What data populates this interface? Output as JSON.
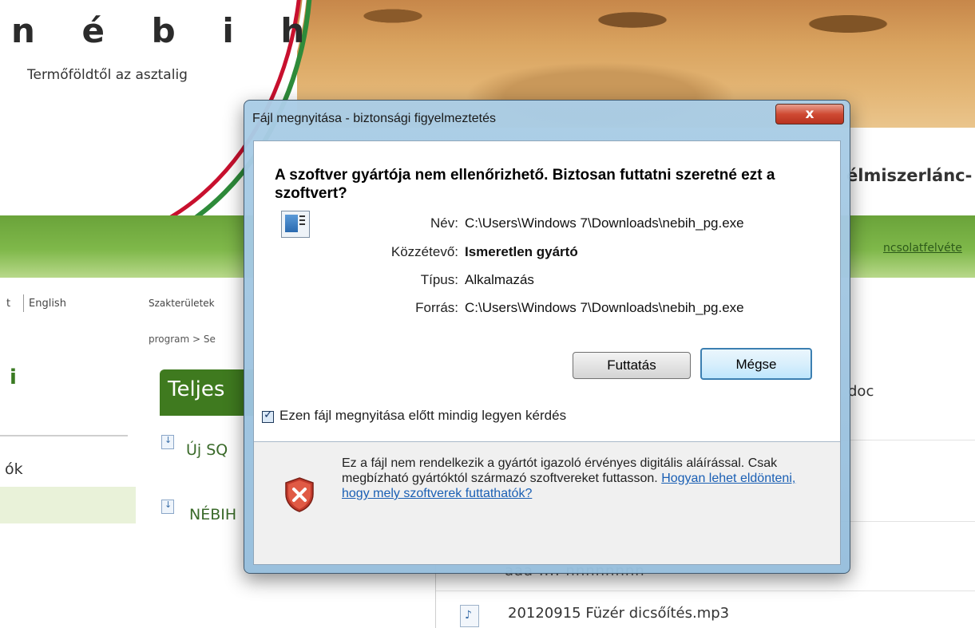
{
  "site": {
    "logo": "n é b i h",
    "tagline": "Termőföldtől az asztalig",
    "header_right_text": "élmiszerlánc-",
    "greenbar_link": "ncsolatfelvéte",
    "lang_prefix": "t",
    "lang_english": "English",
    "nav_heading_fragment": "i",
    "nav_item_fragment": "ók",
    "breadcrumb_1": "Szakterületek",
    "breadcrumb_2": "program > Se",
    "content_tab": "Teljes",
    "content_items": [
      "Új SQ",
      "NÉBIH"
    ],
    "file_list": {
      "doc_fragment": "doc",
      "partial_row": "aaa ....  nnnnnnnn",
      "mp3_name": "20120915 Füzér dicsőítés.mp3"
    }
  },
  "dialog": {
    "title": "Fájl megnyitása - biztonsági figyelmeztetés",
    "close_glyph": "x",
    "heading": "A szoftver gyártója nem ellenőrizhető. Biztosan futtatni szeretné ezt a szoftvert?",
    "fields": [
      {
        "label": "Név:",
        "value": "C:\\Users\\Windows 7\\Downloads\\nebih_pg.exe"
      },
      {
        "label": "Közzétevő:",
        "value": "Ismeretlen gyártó"
      },
      {
        "label": "Típus:",
        "value": "Alkalmazás"
      },
      {
        "label": "Forrás:",
        "value": "C:\\Users\\Windows 7\\Downloads\\nebih_pg.exe"
      }
    ],
    "buttons": {
      "run": "Futtatás",
      "cancel": "Mégse"
    },
    "checkbox_label": "Ezen fájl megnyitása előtt mindig legyen kérdés",
    "checkbox_checked": true,
    "warning_text": "Ez a fájl nem rendelkezik a gyártót igazoló érvényes digitális aláírással. Csak megbízható gyártóktól származó szoftvereket futtasson.",
    "warning_link": "Hogyan lehet eldönteni, hogy mely szoftverek futtathatók?",
    "icons": {
      "app": "application-icon",
      "shield": "shield-error-icon"
    }
  }
}
